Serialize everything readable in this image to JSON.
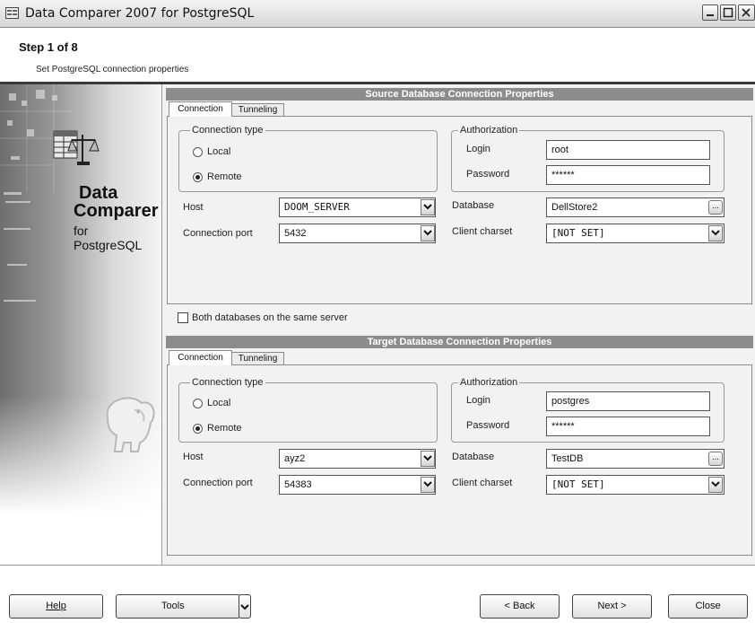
{
  "window": {
    "title": "Data Comparer 2007 for PostgreSQL"
  },
  "header": {
    "step": "Step 1 of 8",
    "subtitle": "Set PostgreSQL connection properties"
  },
  "branding": {
    "line1": "Data",
    "line2": "Comparer",
    "line3": "for",
    "line4": "PostgreSQL"
  },
  "source": {
    "section_title": "Source Database Connection Properties",
    "tabs": [
      "Connection",
      "Tunneling"
    ],
    "connection_type_label": "Connection type",
    "local_label": "Local",
    "remote_label": "Remote",
    "selected": "Remote",
    "host_label": "Host",
    "host_value": "DOOM_SERVER",
    "port_label": "Connection port",
    "port_value": "5432",
    "auth_label": "Authorization",
    "login_label": "Login",
    "login_value": "root",
    "password_label": "Password",
    "password_value": "******",
    "database_label": "Database",
    "database_value": "DellStore2",
    "charset_label": "Client charset",
    "charset_value": "[NOT SET]"
  },
  "same_server_label": "Both databases on the same server",
  "target": {
    "section_title": "Target Database Connection Properties",
    "tabs": [
      "Connection",
      "Tunneling"
    ],
    "connection_type_label": "Connection type",
    "local_label": "Local",
    "remote_label": "Remote",
    "selected": "Remote",
    "host_label": "Host",
    "host_value": "ayz2",
    "port_label": "Connection port",
    "port_value": "54383",
    "auth_label": "Authorization",
    "login_label": "Login",
    "login_value": "postgres",
    "password_label": "Password",
    "password_value": "******",
    "database_label": "Database",
    "database_value": "TestDB",
    "charset_label": "Client charset",
    "charset_value": "[NOT SET]"
  },
  "buttons": {
    "help": "Help",
    "tools": "Tools",
    "back": "< Back",
    "next": "Next >",
    "close": "Close"
  },
  "icons": {
    "app": "app-icon",
    "minimize": "minimize-icon",
    "maximize": "maximize-icon",
    "close": "close-icon",
    "dropdown": "chevron-down-icon",
    "ellipsis": "ellipsis-icon",
    "logo": "data-comparer-logo-icon",
    "elephant": "postgresql-elephant-icon"
  }
}
